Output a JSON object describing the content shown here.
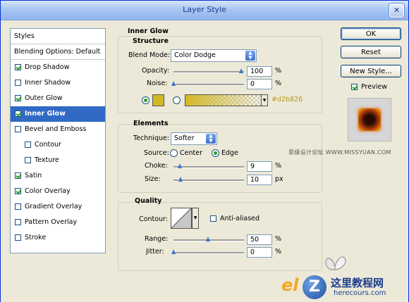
{
  "window": {
    "title": "Layer Style",
    "close_glyph": "✕"
  },
  "styles_panel": {
    "header": "Styles",
    "blending_options": "Blending Options: Default",
    "items": [
      {
        "label": "Drop Shadow",
        "checked": true
      },
      {
        "label": "Inner Shadow",
        "checked": false
      },
      {
        "label": "Outer Glow",
        "checked": true
      },
      {
        "label": "Inner Glow",
        "checked": true,
        "selected": true
      },
      {
        "label": "Bevel and Emboss",
        "checked": false
      },
      {
        "label": "Contour",
        "checked": false,
        "sub": true
      },
      {
        "label": "Texture",
        "checked": false,
        "sub": true
      },
      {
        "label": "Satin",
        "checked": true
      },
      {
        "label": "Color Overlay",
        "checked": true
      },
      {
        "label": "Gradient Overlay",
        "checked": false
      },
      {
        "label": "Pattern Overlay",
        "checked": false
      },
      {
        "label": "Stroke",
        "checked": false
      }
    ]
  },
  "buttons": {
    "ok": "OK",
    "reset": "Reset",
    "new_style": "New Style...",
    "preview": "Preview",
    "preview_checked": true
  },
  "inner_glow": {
    "title": "Inner Glow",
    "structure": {
      "title": "Structure",
      "blend_mode_label": "Blend Mode:",
      "blend_mode_value": "Color Dodge",
      "opacity_label": "Opacity:",
      "opacity_value": "100",
      "opacity_unit": "%",
      "noise_label": "Noise:",
      "noise_value": "0",
      "noise_unit": "%",
      "color_hex": "#d2b826",
      "color_selected": "solid"
    },
    "elements": {
      "title": "Elements",
      "technique_label": "Technique:",
      "technique_value": "Softer",
      "source_label": "Source:",
      "source_center": "Center",
      "source_edge": "Edge",
      "source_selected": "Edge",
      "choke_label": "Choke:",
      "choke_value": "9",
      "choke_unit": "%",
      "size_label": "Size:",
      "size_value": "10",
      "size_unit": "px"
    },
    "quality": {
      "title": "Quality",
      "contour_label": "Contour:",
      "anti_aliased_label": "Anti-aliased",
      "anti_aliased_checked": false,
      "range_label": "Range:",
      "range_value": "50",
      "range_unit": "%",
      "jitter_label": "Jitter:",
      "jitter_value": "0",
      "jitter_unit": "%"
    }
  },
  "watermarks": {
    "top_right": "思缘设计论坛  WWW.MISSYUAN.COM",
    "logo_prefix": "el",
    "logo_cn": "这里教程网",
    "logo_url": "herecours.com"
  },
  "colors": {
    "glow": "#d2b826",
    "selection": "#316ac5",
    "preview_orange": "#e06a10"
  }
}
